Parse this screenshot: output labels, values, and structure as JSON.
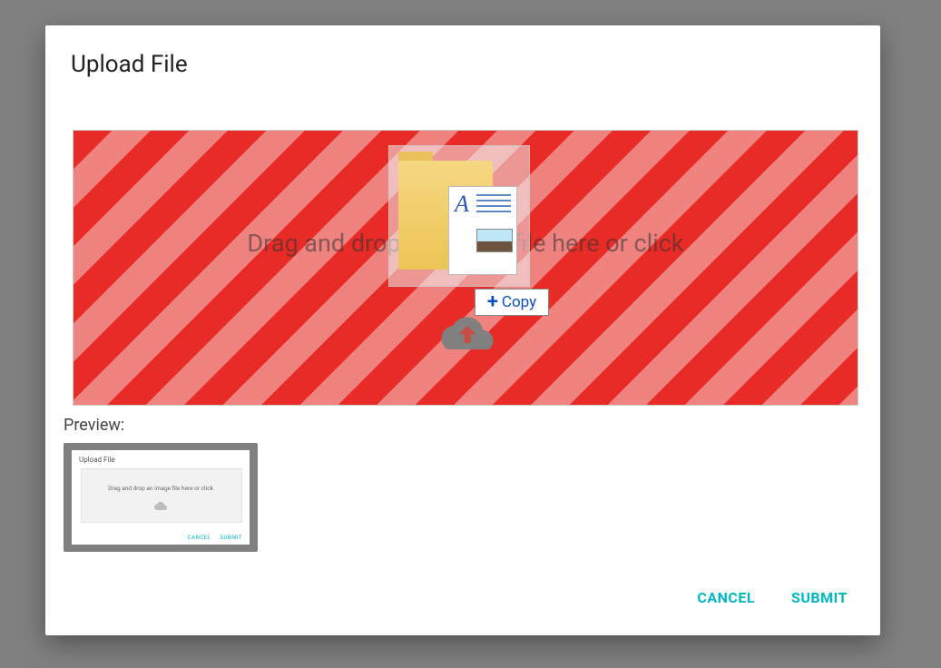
{
  "dialog_title": "Upload File",
  "dropzone": {
    "prompt": "Drag and drop an image file here or click",
    "copy_badge": "Copy"
  },
  "preview": {
    "label": "Preview:",
    "mini_title": "Upload File",
    "mini_prompt": "Drag and drop an image file here or click",
    "mini_cancel": "CANCEL",
    "mini_submit": "SUBMIT"
  },
  "actions": {
    "cancel": "CANCEL",
    "submit": "SUBMIT"
  }
}
